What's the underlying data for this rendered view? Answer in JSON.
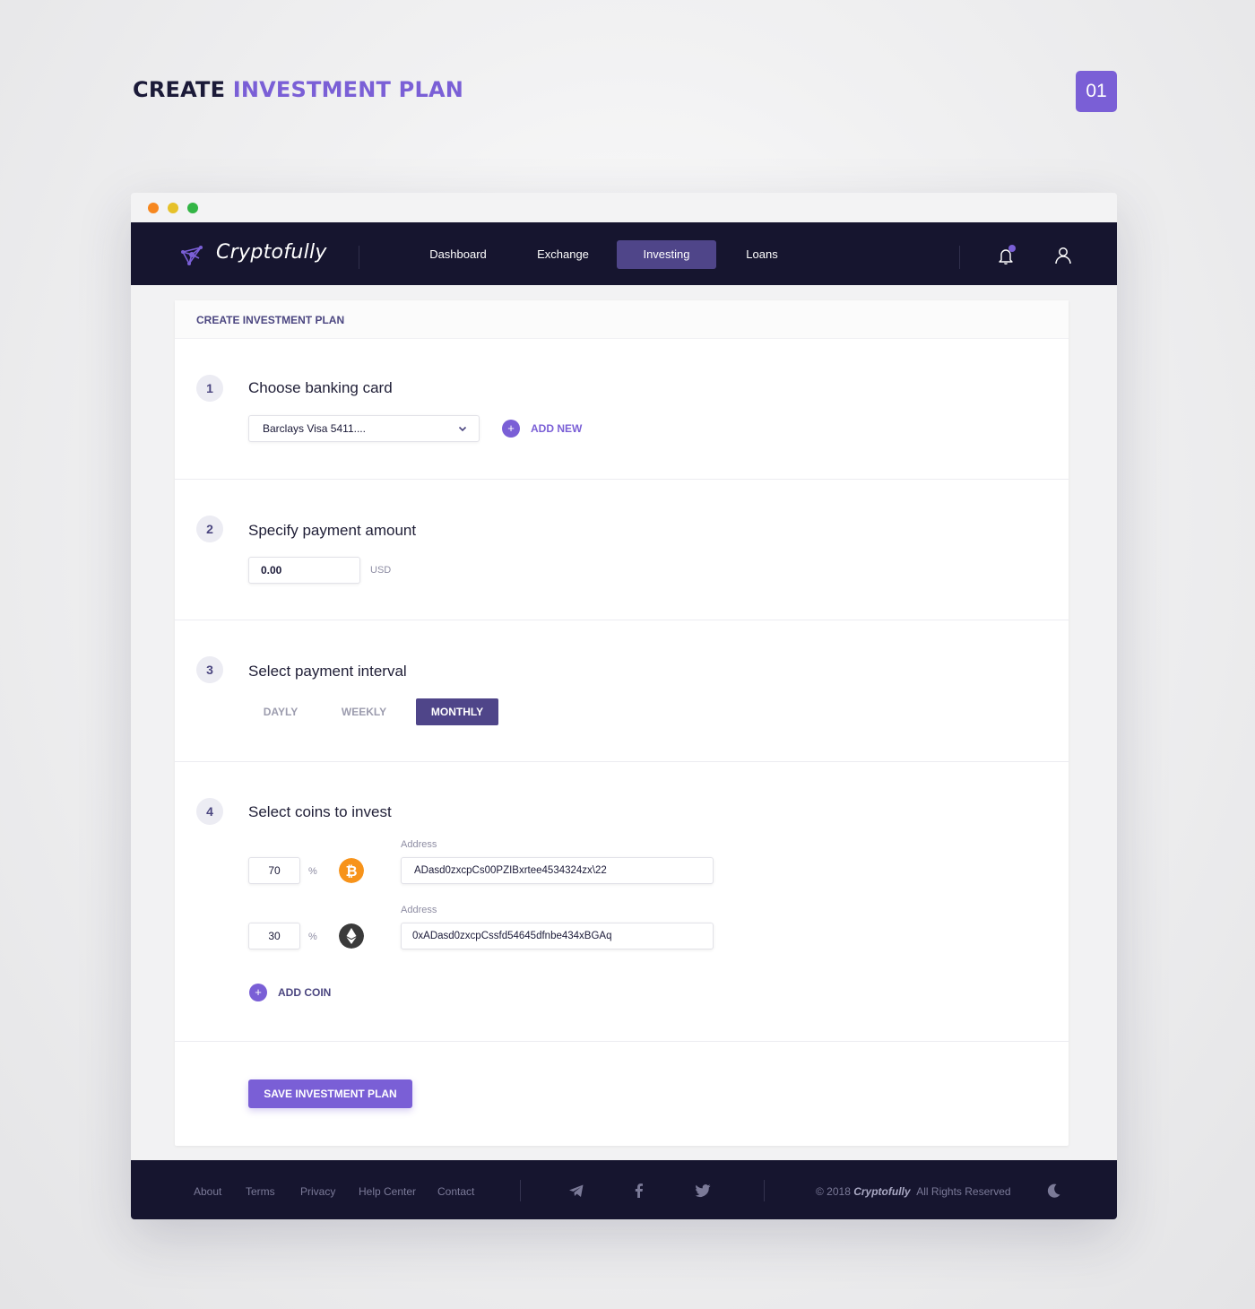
{
  "page": {
    "heading_dark": "CREATE",
    "heading_accent": "INVESTMENT PLAN",
    "badge": "01"
  },
  "brand": {
    "name": "Cryptofully"
  },
  "nav": {
    "items": [
      {
        "label": "Dashboard"
      },
      {
        "label": "Exchange"
      },
      {
        "label": "Investing",
        "active": true
      },
      {
        "label": "Loans"
      }
    ]
  },
  "card": {
    "title": "CREATE INVESTMENT PLAN",
    "steps": [
      {
        "num": "1",
        "title": "Choose banking card"
      },
      {
        "num": "2",
        "title": "Specify payment amount"
      },
      {
        "num": "3",
        "title": "Select payment interval"
      },
      {
        "num": "4",
        "title": "Select coins to invest"
      }
    ],
    "card_select": {
      "value": "Barclays Visa 5411...."
    },
    "add_new_label": "ADD NEW",
    "amount": {
      "value": "0.00",
      "currency": "USD"
    },
    "intervals": [
      {
        "label": "DAYLY"
      },
      {
        "label": "WEEKLY"
      },
      {
        "label": "MONTHLY",
        "active": true
      }
    ],
    "coins": [
      {
        "percent": "70",
        "unit": "%",
        "icon": "bitcoin-icon",
        "address_label": "Address",
        "address": "ADasd0zxcpCs00PZIBxrtee4534324zx\\22"
      },
      {
        "percent": "30",
        "unit": "%",
        "icon": "ethereum-icon",
        "address_label": "Address",
        "address": "0xADasd0zxcpCssfd54645dfnbe434xBGAq"
      }
    ],
    "add_coin_label": "ADD COIN",
    "save_label": "SAVE INVESTMENT PLAN"
  },
  "footer": {
    "links": [
      "About",
      "Terms",
      "Privacy",
      "Help Center",
      "Contact"
    ],
    "copyright_prefix": "© 2018",
    "copyright_brand": "Cryptofully",
    "copyright_suffix": "All Rights Reserved"
  },
  "colors": {
    "accent": "#7a5fd6",
    "navy": "#16152f",
    "active_tab": "#4f4589",
    "bitcoin": "#f7931a",
    "ethereum": "#3a3a3a"
  }
}
